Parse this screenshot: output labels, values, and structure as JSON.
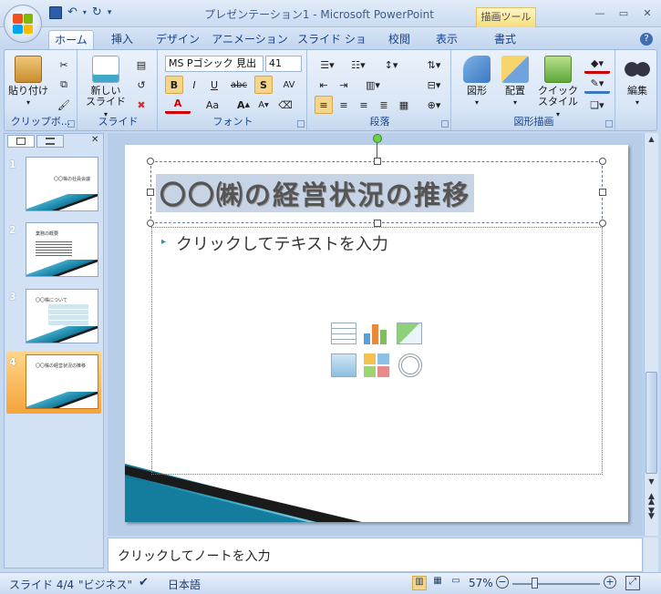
{
  "window": {
    "title": "プレゼンテーション1 - Microsoft PowerPoint",
    "context_tab": "描画ツール"
  },
  "tabs": [
    "ホーム",
    "挿入",
    "デザイン",
    "アニメーション",
    "スライド ショー",
    "校閲",
    "表示",
    "書式"
  ],
  "ribbon": {
    "clipboard": {
      "label": "クリップボ...",
      "paste": "貼り付け"
    },
    "slides": {
      "label": "スライド",
      "new_slide_line1": "新しい",
      "new_slide_line2": "スライド"
    },
    "font": {
      "label": "フォント",
      "font_name": "MS Pゴシック 見出",
      "font_size": "41",
      "bold": "B",
      "italic": "I",
      "underline": "U",
      "strike": "abc",
      "shadow": "S",
      "spacing": "AV",
      "aa": "Aa"
    },
    "paragraph": {
      "label": "段落"
    },
    "drawing": {
      "label": "図形描画",
      "shapes": "図形",
      "arrange": "配置",
      "quick_style_line1": "クイック",
      "quick_style_line2": "スタイル"
    },
    "editing": {
      "label": "編集"
    }
  },
  "thumbnails": [
    {
      "num": "1",
      "title": "〇〇株の社員会議"
    },
    {
      "num": "2",
      "title": "業務の概要"
    },
    {
      "num": "3",
      "title": "〇〇株について"
    },
    {
      "num": "4",
      "title": "〇〇株の経営状況の推移"
    }
  ],
  "slide": {
    "title": "〇〇㈱の経営状況の推移",
    "body_placeholder": "クリックしてテキストを入力"
  },
  "notes": {
    "placeholder": "クリックしてノートを入力"
  },
  "status": {
    "slide": "スライド 4/4",
    "theme": "\"ビジネス\"",
    "language": "日本語",
    "zoom": "57%"
  }
}
